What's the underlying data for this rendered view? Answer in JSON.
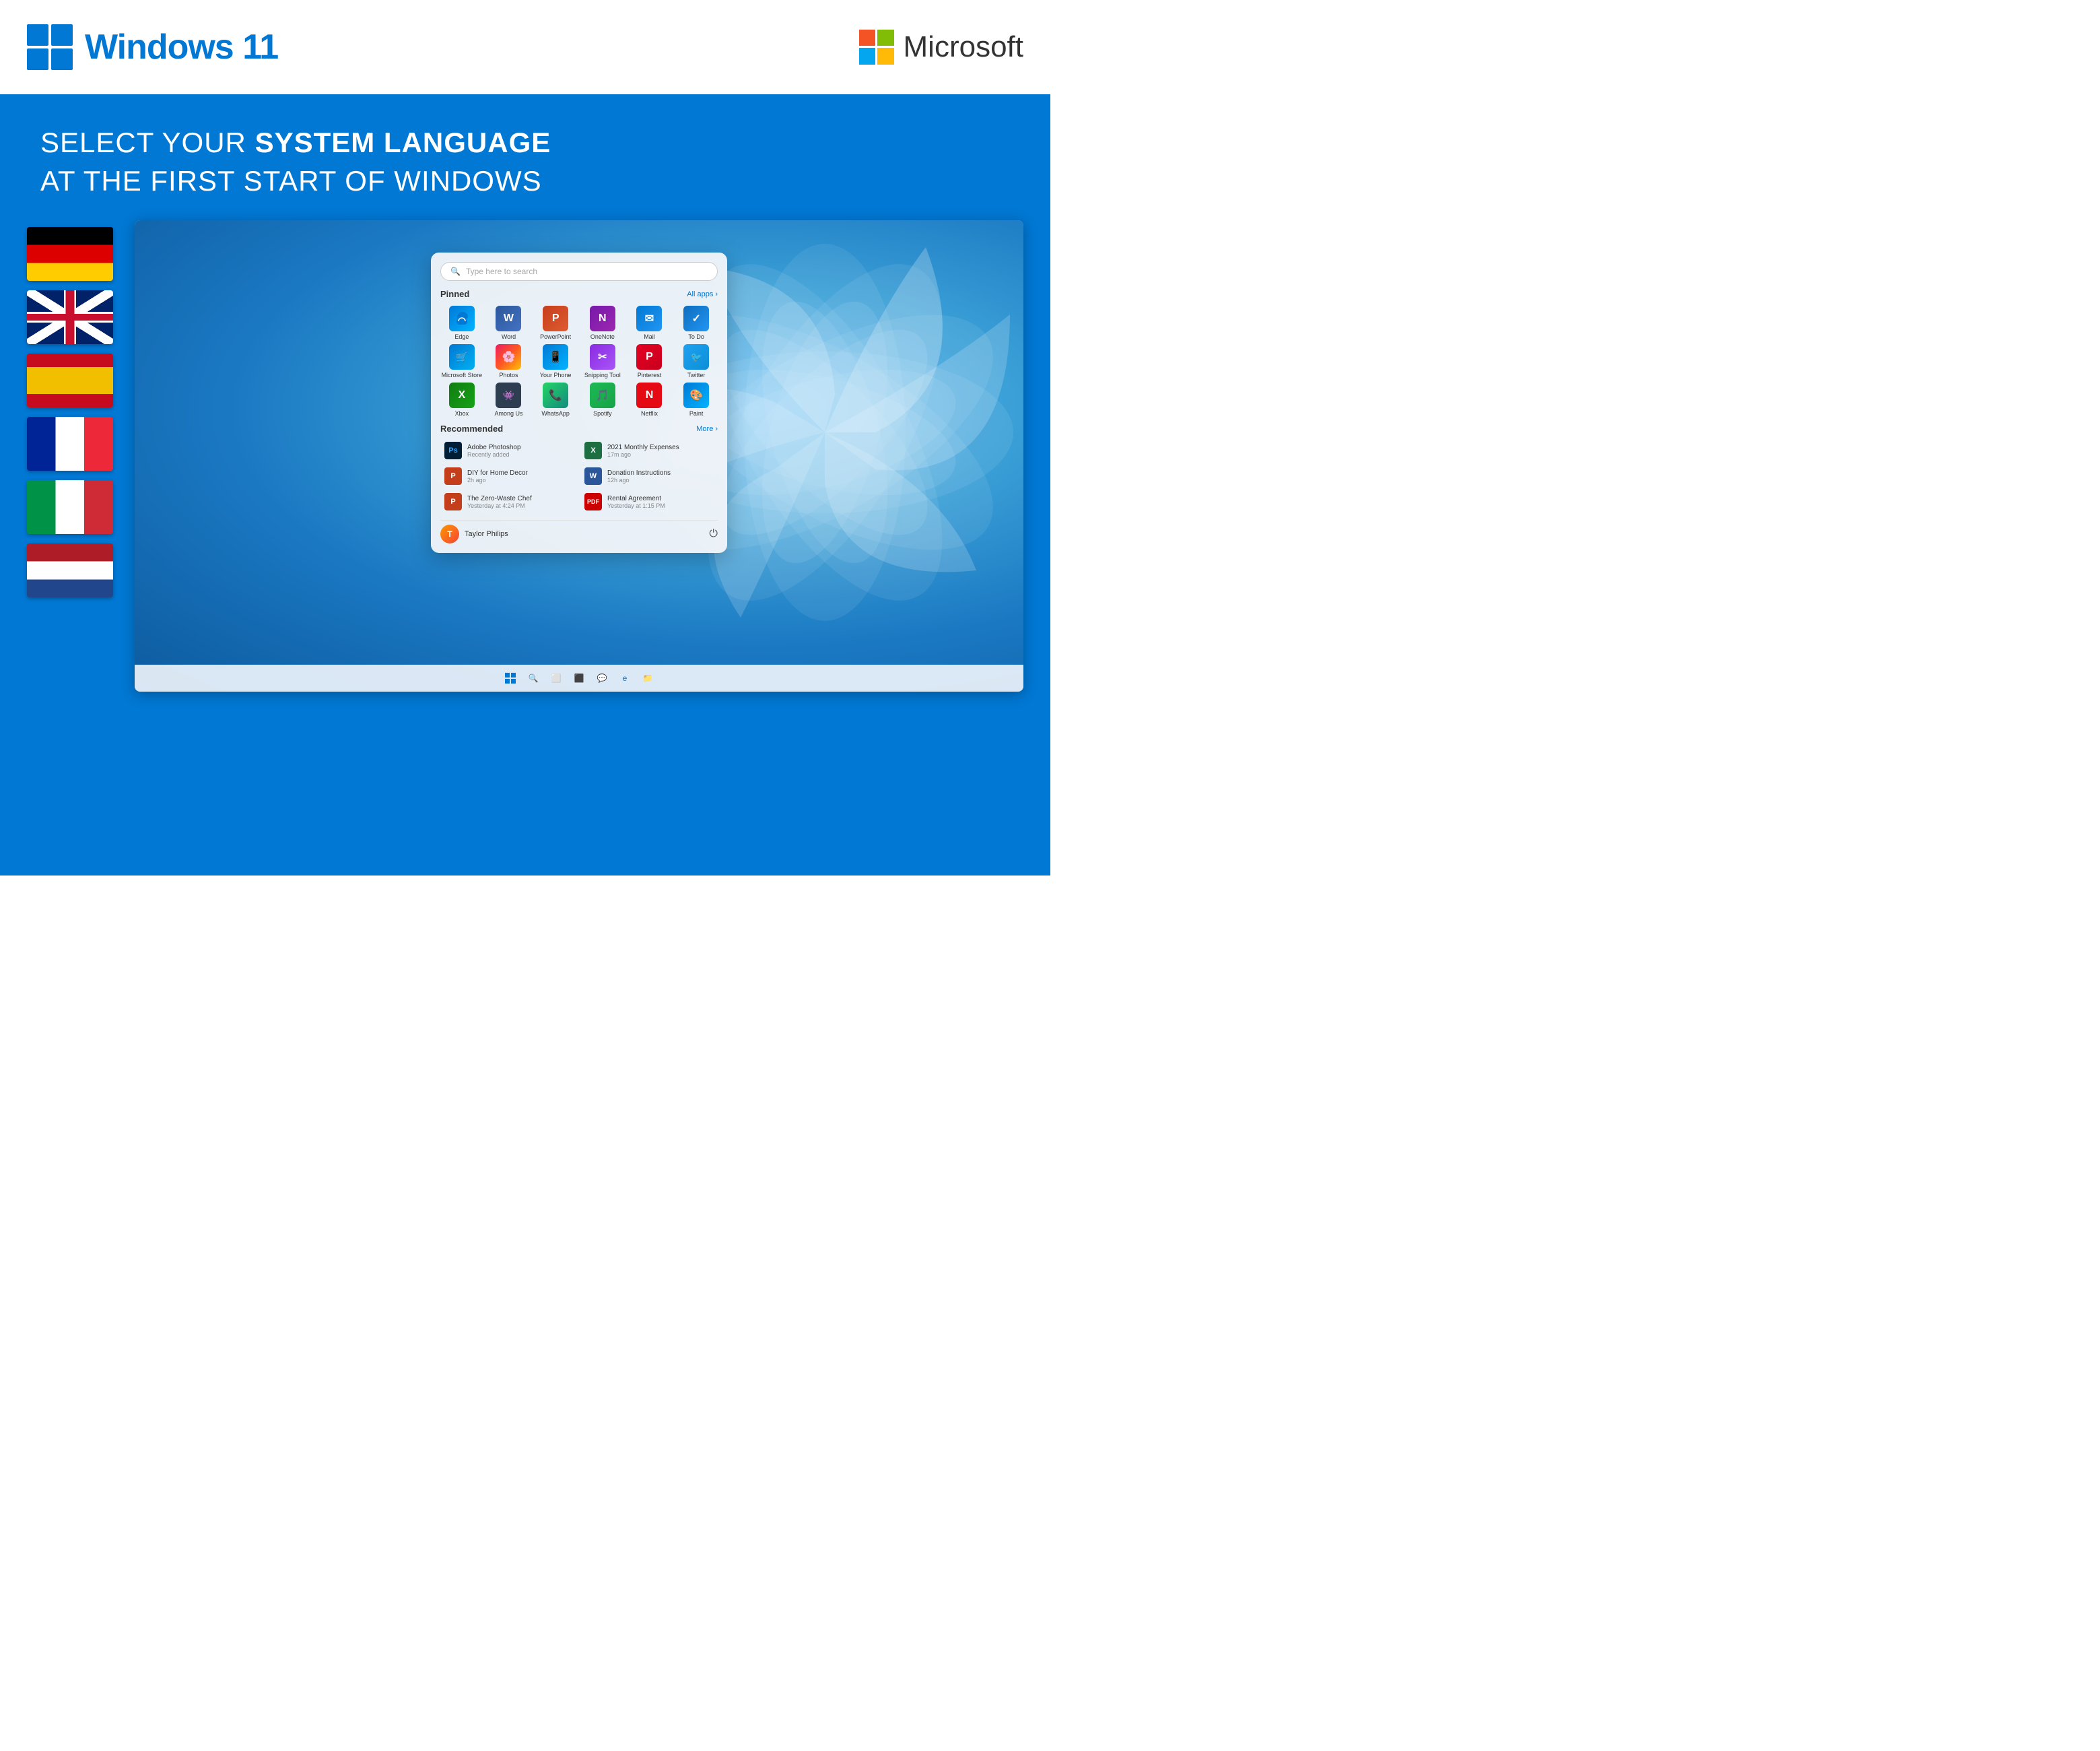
{
  "header": {
    "windows_logo_title": "Windows 11",
    "windows_title_regular": "Windows ",
    "windows_title_bold": "11",
    "microsoft_title": "Microsoft"
  },
  "blue_section": {
    "headline_line1": "SELECT YOUR ",
    "headline_bold": "SYSTEM LANGUAGE",
    "headline_line2": "AT THE FIRST START OF WINDOWS"
  },
  "flags": [
    {
      "id": "de",
      "label": "German"
    },
    {
      "id": "uk",
      "label": "English UK"
    },
    {
      "id": "es",
      "label": "Spanish"
    },
    {
      "id": "fr",
      "label": "French"
    },
    {
      "id": "it",
      "label": "Italian"
    },
    {
      "id": "nl",
      "label": "Dutch"
    }
  ],
  "start_menu": {
    "search_placeholder": "Type here to search",
    "pinned_label": "Pinned",
    "all_apps_label": "All apps",
    "recommended_label": "Recommended",
    "more_label": "More",
    "apps": [
      {
        "name": "Edge",
        "icon_class": "icon-edge",
        "symbol": "e"
      },
      {
        "name": "Word",
        "icon_class": "icon-word",
        "symbol": "W"
      },
      {
        "name": "PowerPoint",
        "icon_class": "icon-ppt",
        "symbol": "P"
      },
      {
        "name": "OneNote",
        "icon_class": "icon-onenote",
        "symbol": "N"
      },
      {
        "name": "Mail",
        "icon_class": "icon-mail",
        "symbol": "✉"
      },
      {
        "name": "To Do",
        "icon_class": "icon-todo",
        "symbol": "✓"
      },
      {
        "name": "Microsoft Store",
        "icon_class": "icon-store",
        "symbol": "🛒"
      },
      {
        "name": "Photos",
        "icon_class": "icon-photos",
        "symbol": "🌸"
      },
      {
        "name": "Your Phone",
        "icon_class": "icon-yourphone",
        "symbol": "📱"
      },
      {
        "name": "Snipping Tool",
        "icon_class": "icon-snipping",
        "symbol": "✂"
      },
      {
        "name": "Pinterest",
        "icon_class": "icon-pinterest",
        "symbol": "P"
      },
      {
        "name": "Twitter",
        "icon_class": "icon-twitter",
        "symbol": "🐦"
      },
      {
        "name": "Xbox",
        "icon_class": "icon-xbox",
        "symbol": "X"
      },
      {
        "name": "Among Us",
        "icon_class": "icon-among",
        "symbol": "👾"
      },
      {
        "name": "WhatsApp",
        "icon_class": "icon-whatsapp",
        "symbol": "📞"
      },
      {
        "name": "Spotify",
        "icon_class": "icon-spotify",
        "symbol": "♪"
      },
      {
        "name": "Netflix",
        "icon_class": "icon-netflix",
        "symbol": "N"
      },
      {
        "name": "Paint",
        "icon_class": "icon-paint",
        "symbol": "🎨"
      }
    ],
    "recommended": [
      {
        "name": "Adobe Photoshop",
        "time": "Recently added",
        "color": "#001e36"
      },
      {
        "name": "2021 Monthly Expenses",
        "time": "17m ago",
        "color": "#1d6f42"
      },
      {
        "name": "DIY for Home Decor",
        "time": "2h ago",
        "color": "#c43e1c"
      },
      {
        "name": "Donation Instructions",
        "time": "12h ago",
        "color": "#2b579a"
      },
      {
        "name": "The Zero-Waste Chef",
        "time": "Yesterday at 4:24 PM",
        "color": "#c43e1c"
      },
      {
        "name": "Rental Agreement",
        "time": "Yesterday at 1:15 PM",
        "color": "#c00"
      }
    ],
    "user_name": "Taylor Philips"
  }
}
